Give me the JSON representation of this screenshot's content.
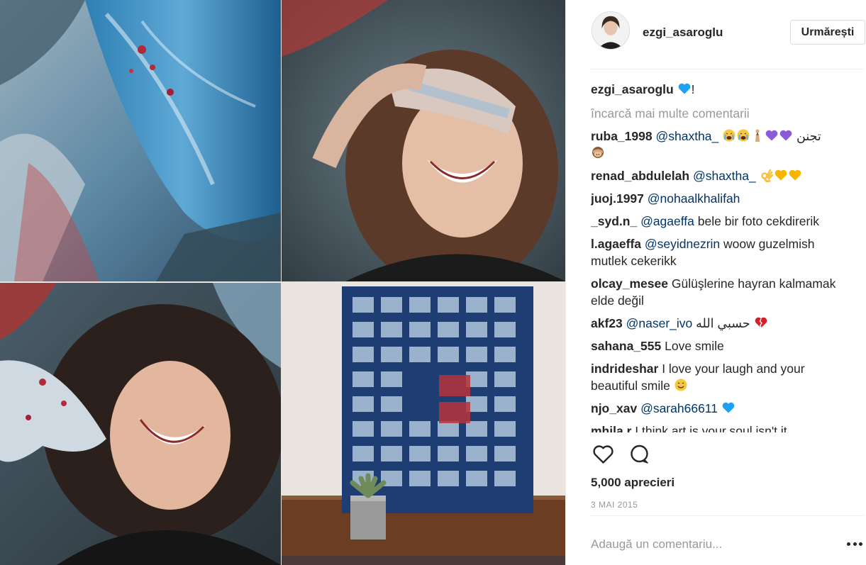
{
  "post": {
    "username": "ezgi_asaroglu",
    "follow_label": "Urmărești",
    "caption": {
      "user": "ezgi_asaroglu",
      "emojis": [
        "blue-heart"
      ],
      "suffix": "!"
    },
    "load_more_label": "încarcă mai multe comentarii",
    "comments": [
      {
        "user": "ruba_1998",
        "mention": "@shaxtha_",
        "text": "",
        "emojis_after": [
          "crying-face",
          "crying-face",
          "praying-person",
          "purple-heart",
          "purple-heart"
        ],
        "trailing_text": "تجنن",
        "extra_emojis": [
          "see-no-evil-monkey"
        ]
      },
      {
        "user": "renad_abdulelah",
        "mention": "@shaxtha_",
        "text": "",
        "emojis_after": [
          "ok-hand",
          "yellow-heart",
          "yellow-heart"
        ]
      },
      {
        "user": "juoj.1997",
        "mention": "@nohaalkhalifah",
        "text": ""
      },
      {
        "user": "_syd.n_",
        "mention": "@agaeffa",
        "text": "bele bir foto cekdirerik"
      },
      {
        "user": "l.agaeffa",
        "mention": "@seyidnezrin",
        "text": "woow guzelmish mutlek cekerikk"
      },
      {
        "user": "olcay_mesee",
        "mention": "",
        "text": "Gülüşlerine hayran kalmamak elde değil"
      },
      {
        "user": "akf23",
        "mention": "@naser_ivo",
        "text": "حسبي الله",
        "emojis_after": [
          "broken-heart"
        ]
      },
      {
        "user": "sahana_555",
        "mention": "",
        "text": "Love smile"
      },
      {
        "user": "indrideshar",
        "mention": "",
        "text": "I love your laugh and your beautiful smile",
        "emojis_after": [
          "smiling-face"
        ]
      },
      {
        "user": "njo_xav",
        "mention": "@sarah66611",
        "text": "",
        "emojis_after": [
          "blue-heart"
        ]
      },
      {
        "user": "mhila.r",
        "mention": "",
        "text": "I think art is your soul isn't it"
      }
    ],
    "actions": {
      "like_icon": "heart-outline-icon",
      "comment_icon": "speech-bubble-icon"
    },
    "likes_label": "5,000 aprecieri",
    "date_label": "3 MAI 2015",
    "comment_placeholder": "Adaugă un comentariu...",
    "more_icon": "ellipsis-icon"
  },
  "colors": {
    "text": "#262626",
    "mention": "#003569",
    "muted": "#999999",
    "divider": "#efefef",
    "blue_heart": "#1da1f2",
    "purple_heart": "#8a5bd6",
    "yellow_heart": "#f7b500",
    "red_heart": "#d4202b"
  },
  "media": {
    "tiles": [
      "painted-canvas-closeup",
      "laughing-woman-hand-over-eyes",
      "laughing-woman-painted-hand",
      "blue-grid-painting-with-succulent"
    ]
  }
}
